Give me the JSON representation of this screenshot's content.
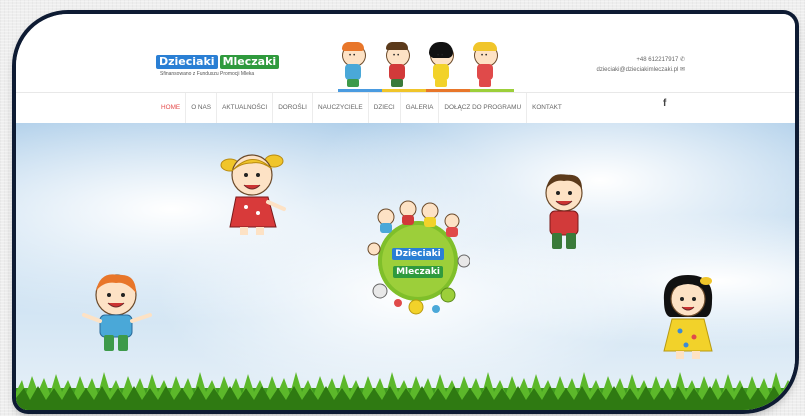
{
  "logo": {
    "word1": "Dzieciaki",
    "word2": "Mleczaki",
    "subtitle": "Sfinansowano z Funduszu Promocji Mleka"
  },
  "contact": {
    "phone": "+48 612217917",
    "email": "dzieciaki@dzieciakimleczaki.pl"
  },
  "nav": {
    "items": [
      {
        "label": "HOME",
        "active": true
      },
      {
        "label": "O NAS"
      },
      {
        "label": "AKTUALNOŚCI"
      },
      {
        "label": "DOROŚLI"
      },
      {
        "label": "NAUCZYCIELE"
      },
      {
        "label": "DZIECI"
      },
      {
        "label": "GALERIA"
      },
      {
        "label": "DOŁĄCZ DO PROGRAMU"
      },
      {
        "label": "KONTAKT"
      }
    ],
    "facebook": "f"
  },
  "hero": {
    "logo_word1": "Dzieciaki",
    "logo_word2": "Mleczaki"
  },
  "colors": {
    "accent_bar": [
      "#4a9be0",
      "#f0c52a",
      "#e8762a",
      "#9ccf3a"
    ],
    "active_nav": "#e54b4b",
    "frame": "#0e1b33"
  }
}
